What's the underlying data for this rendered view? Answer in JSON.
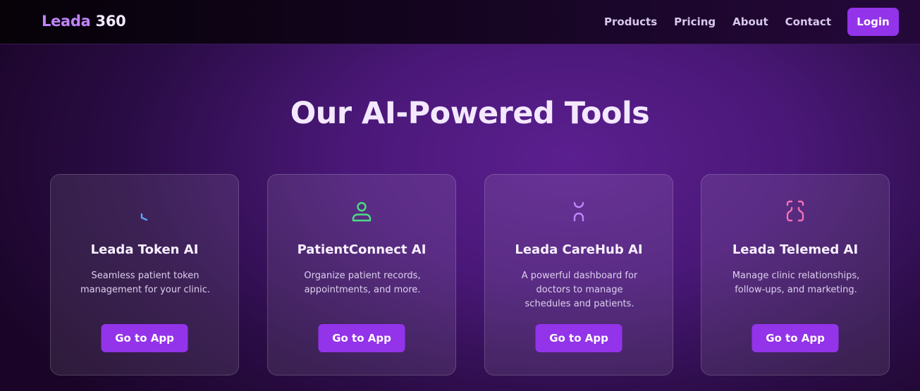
{
  "nav": {
    "brand_part1": "Leada",
    "brand_part2": "360",
    "links": [
      "Products",
      "Pricing",
      "About",
      "Contact"
    ],
    "login_label": "Login"
  },
  "main": {
    "title": "Our AI-Powered Tools",
    "cards": [
      {
        "title": "Leada Token AI",
        "description": "Seamless patient token management for your clinic.",
        "button": "Go to App",
        "icon": "clock-icon",
        "icon_color": "#60a5fa"
      },
      {
        "title": "PatientConnect AI",
        "description": "Organize patient records, appointments, and more.",
        "button": "Go to App",
        "icon": "user-icon",
        "icon_color": "#4ade80"
      },
      {
        "title": "Leada CareHub AI",
        "description": "A powerful dashboard for doctors to manage schedules and patients.",
        "button": "Go to App",
        "icon": "stethoscope-icon",
        "icon_color": "#c084fc"
      },
      {
        "title": "Leada Telemed AI",
        "description": "Manage clinic relationships, follow-ups, and marketing.",
        "button": "Go to App",
        "icon": "scan-face-icon",
        "icon_color": "#f472b6"
      }
    ]
  },
  "colors": {
    "accent": "#9333ea",
    "brand_accent": "#c084fc"
  }
}
